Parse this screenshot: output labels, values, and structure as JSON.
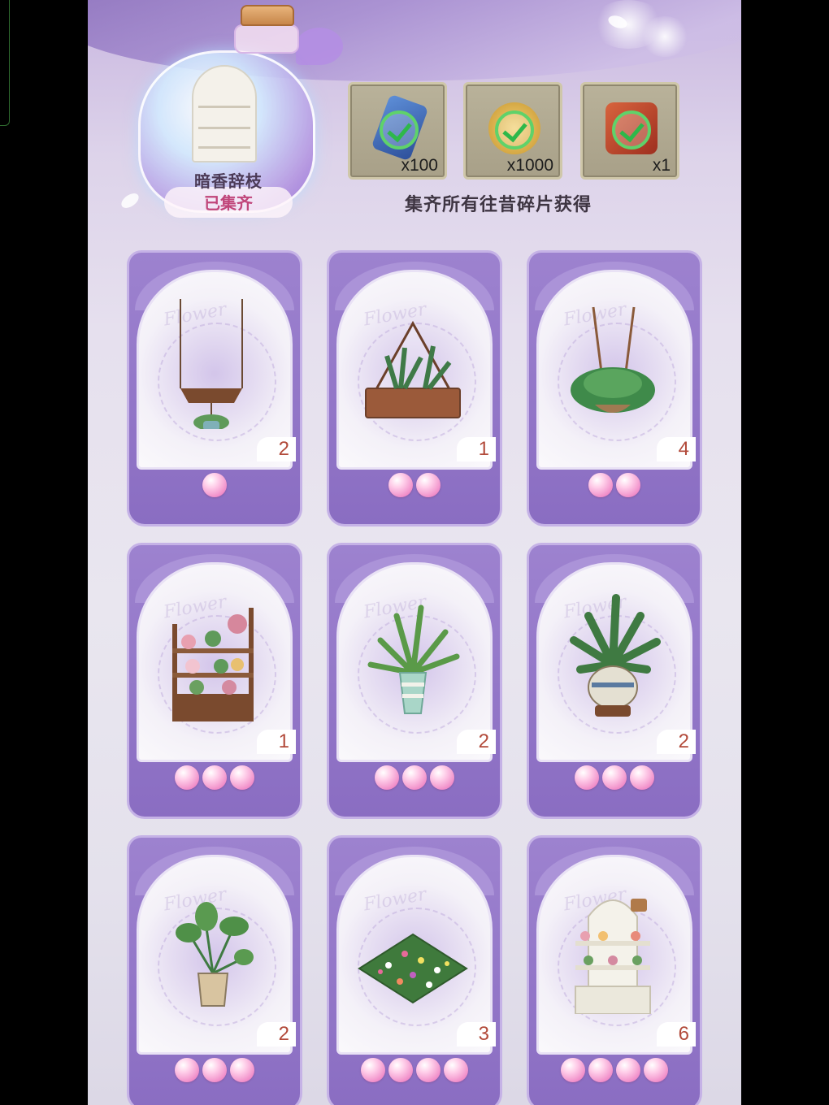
{
  "collection": {
    "name": "暗香辞枝",
    "status": "已集齐"
  },
  "rewards": [
    {
      "icon": "blue-shard-icon",
      "quantity": "x100",
      "claimed": true
    },
    {
      "icon": "gold-clover-coin-icon",
      "quantity": "x1000",
      "claimed": true
    },
    {
      "icon": "red-treasure-chest-icon",
      "quantity": "x1",
      "claimed": true
    }
  ],
  "reward_note": "集齐所有往昔碎片获得",
  "cards": [
    {
      "item": "hanging-shelf-planter",
      "count": "2",
      "rarity": 1
    },
    {
      "item": "glass-terrarium",
      "count": "1",
      "rarity": 2
    },
    {
      "item": "hanging-fern-basket",
      "count": "4",
      "rarity": 2
    },
    {
      "item": "flower-display-shelf",
      "count": "1",
      "rarity": 3
    },
    {
      "item": "striped-pot-plant",
      "count": "2",
      "rarity": 3
    },
    {
      "item": "porcelain-pot-plant",
      "count": "2",
      "rarity": 3
    },
    {
      "item": "small-pot-plant",
      "count": "2",
      "rarity": 3
    },
    {
      "item": "flower-bed-tile",
      "count": "3",
      "rarity": 4
    },
    {
      "item": "white-flower-cabinet",
      "count": "6",
      "rarity": 4
    }
  ],
  "colors": {
    "frame": "#8a6dc2",
    "pearl": "#f08cc8",
    "count_text": "#b24a3a",
    "status_text": "#c0457a"
  }
}
